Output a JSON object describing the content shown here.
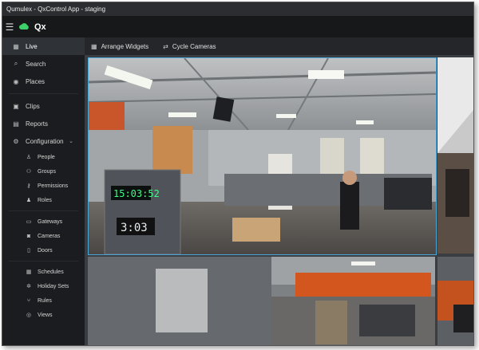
{
  "window": {
    "title": "Qumulex - QxControl App - staging"
  },
  "appbar": {
    "brand": "Qx",
    "menu_icon": "hamburger-icon",
    "logo_icon": "cloud-icon"
  },
  "sidebar": {
    "items": [
      {
        "label": "Live",
        "icon": "grid-icon"
      },
      {
        "label": "Search",
        "icon": "search-icon"
      },
      {
        "label": "Places",
        "icon": "location-pin-icon"
      },
      {
        "label": "Clips",
        "icon": "clip-icon"
      },
      {
        "label": "Reports",
        "icon": "report-icon"
      },
      {
        "label": "Configuration",
        "icon": "gear-icon"
      },
      {
        "label": "People",
        "icon": "person-icon"
      },
      {
        "label": "Groups",
        "icon": "group-icon"
      },
      {
        "label": "Permissions",
        "icon": "key-icon"
      },
      {
        "label": "Roles",
        "icon": "roles-icon"
      },
      {
        "label": "Gateways",
        "icon": "gateway-icon"
      },
      {
        "label": "Cameras",
        "icon": "camera-icon"
      },
      {
        "label": "Doors",
        "icon": "door-icon"
      },
      {
        "label": "Schedules",
        "icon": "schedule-icon"
      },
      {
        "label": "Holiday Sets",
        "icon": "holiday-icon"
      },
      {
        "label": "Rules",
        "icon": "rules-icon"
      },
      {
        "label": "Views",
        "icon": "eye-icon"
      }
    ]
  },
  "toolbar": {
    "arrange_label": "Arrange Widgets",
    "cycle_label": "Cycle Cameras"
  },
  "cameras": {
    "main_clock": "15:03:52",
    "main_counter": "3:03"
  },
  "colors": {
    "accent": "#4aa6d8",
    "active_bg": "#2f3338",
    "led_green": "#3dff8a"
  }
}
